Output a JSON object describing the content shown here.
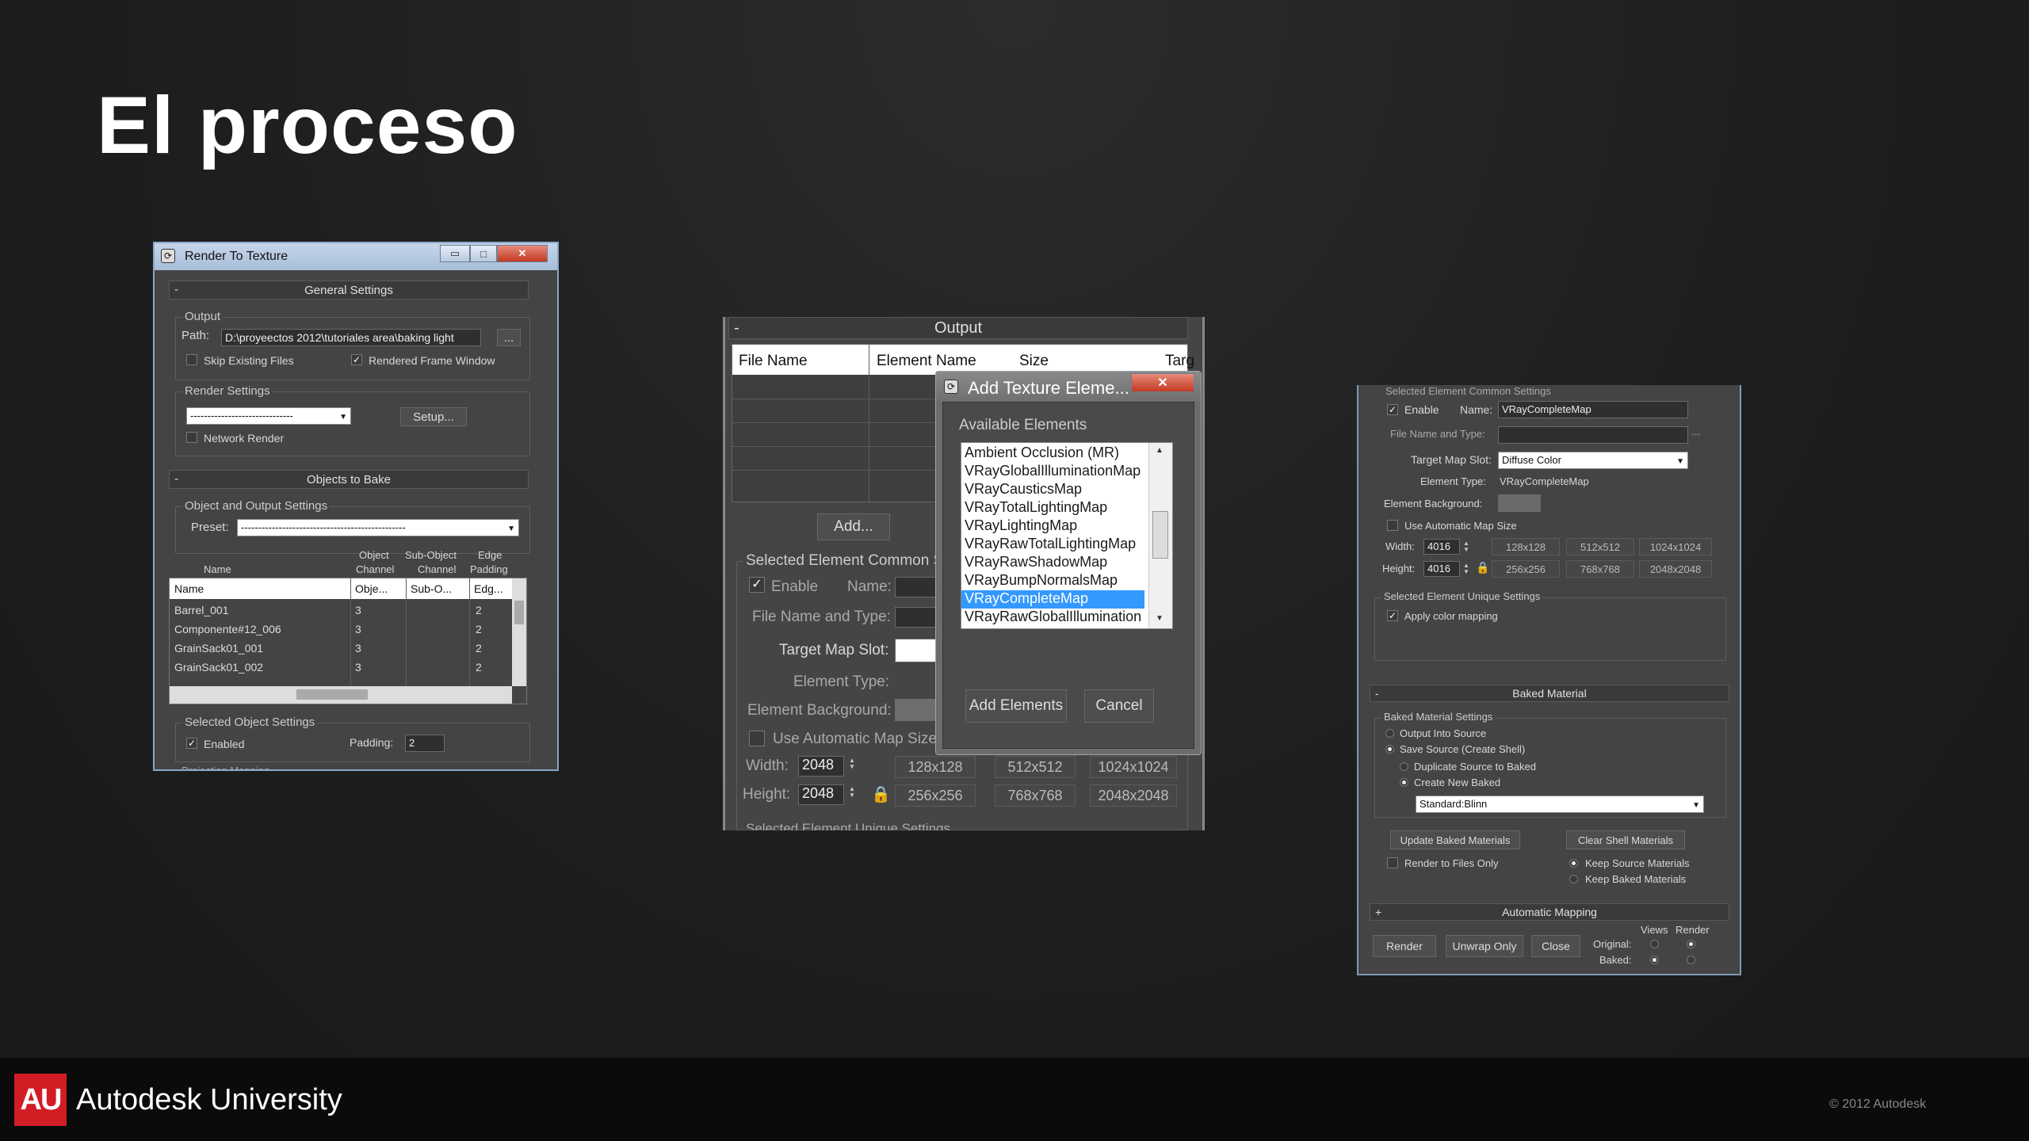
{
  "slide": {
    "title": "El proceso"
  },
  "footer": {
    "logo_text": "AU",
    "brand": "Autodesk University",
    "copyright": "© 2012 Autodesk",
    "logo_color": "#d31d25"
  },
  "win1": {
    "title": "Render To Texture",
    "min_btn": "▭",
    "max_btn": "□",
    "close_btn": "✕",
    "app_icon": "max-logo-icon",
    "general_settings": "General Settings",
    "output_label": "Output",
    "path_label": "Path:",
    "path_value": "D:\\proyeectos 2012\\tutoriales area\\baking light",
    "browse_btn": "...",
    "skip_existing": "Skip Existing Files",
    "rendered_frame_window": "Rendered Frame Window",
    "render_settings": "Render Settings",
    "render_preset_value": "------------------------------",
    "setup_btn": "Setup...",
    "network_render": "Network Render",
    "objects_to_bake": "Objects to Bake",
    "object_output_settings": "Object and Output Settings",
    "preset_label": "Preset:",
    "preset_value": "------------------------------------------------",
    "col_heads": {
      "name": "Name",
      "object_channel_1": "Object",
      "object_channel_2": "Channel",
      "subobject_channel_1": "Sub-Object",
      "subobject_channel_2": "Channel",
      "edge_padding_1": "Edge",
      "edge_padding_2": "Padding"
    },
    "table_header": [
      "Name",
      "Obje...",
      "Sub-O...",
      "Edg..."
    ],
    "rows": [
      [
        "Barrel_001",
        "3",
        "",
        "2"
      ],
      [
        "Componente#12_006",
        "3",
        "",
        "2"
      ],
      [
        "GrainSack01_001",
        "3",
        "",
        "2"
      ],
      [
        "GrainSack01_002",
        "3",
        "",
        "2"
      ]
    ],
    "selected_object_settings": "Selected Object Settings",
    "enabled": "Enabled",
    "padding_label": "Padding:",
    "padding_value": "2",
    "projection_mapping": "Projection Mapping"
  },
  "win2": {
    "output": "Output",
    "columns": [
      "File Name",
      "Element Name",
      "Size",
      "Targ"
    ],
    "add_btn": "Add...",
    "selected_element_common": "Selected Element Common S",
    "enable": "Enable",
    "name_label": "Name:",
    "file_name_type": "File Name and Type:",
    "target_map_slot": "Target Map Slot:",
    "element_type": "Element Type:",
    "element_background": "Element Background:",
    "use_auto_map_size": "Use Automatic Map Size",
    "width_label": "Width:",
    "width_value": "2048",
    "height_label": "Height:",
    "height_value": "2048",
    "sizes": [
      "128x128",
      "512x512",
      "1024x1024",
      "256x256",
      "768x768",
      "2048x2048"
    ],
    "selected_element_unique": "Selected Element Unique Settings"
  },
  "dialog": {
    "title": "Add Texture Eleme...",
    "close_btn": "✕",
    "available_elements": "Available Elements",
    "items": [
      "Ambient Occlusion (MR)",
      "VRayGlobalIlluminationMap",
      "VRayCausticsMap",
      "VRayTotalLightingMap",
      "VRayLightingMap",
      "VRayRawTotalLightingMap",
      "VRayRawShadowMap",
      "VRayBumpNormalsMap",
      "VRayCompleteMap",
      "VRayRawGlobalIllumination"
    ],
    "selected_item": "VRayCompleteMap",
    "add_elements_btn": "Add Elements",
    "cancel_btn": "Cancel"
  },
  "win3": {
    "selected_element_common": "Selected Element Common Settings",
    "enable": "Enable",
    "name_label": "Name:",
    "name_value": "VRayCompleteMap",
    "file_name_type": "File Name and Type:",
    "browse_btn": "...",
    "target_map_slot": "Target Map Slot:",
    "target_map_value": "Diffuse Color",
    "element_type_label": "Element Type:",
    "element_type_value": "VRayCompleteMap",
    "element_background": "Element Background:",
    "use_auto_map_size": "Use Automatic Map Size",
    "width_label": "Width:",
    "width_value": "4016",
    "height_label": "Height:",
    "height_value": "4016",
    "sizes": [
      "128x128",
      "512x512",
      "1024x1024",
      "256x256",
      "768x768",
      "2048x2048"
    ],
    "selected_element_unique": "Selected Element Unique Settings",
    "apply_color_mapping": "Apply color mapping",
    "baked_material": "Baked Material",
    "baked_material_settings": "Baked Material Settings",
    "output_into_source": "Output Into Source",
    "save_source": "Save Source (Create Shell)",
    "duplicate_source": "Duplicate Source to Baked",
    "create_new_baked": "Create New Baked",
    "material_value": "Standard:Blinn",
    "update_baked_btn": "Update Baked Materials",
    "clear_shell_btn": "Clear Shell Materials",
    "render_to_files_only": "Render to Files Only",
    "keep_source_materials": "Keep Source Materials",
    "keep_baked_materials": "Keep Baked Materials",
    "automatic_mapping": "Automatic Mapping",
    "render_btn": "Render",
    "unwrap_only_btn": "Unwrap Only",
    "close_btn": "Close",
    "views_label": "Views",
    "render_label": "Render",
    "original_label": "Original:",
    "baked_label": "Baked:"
  }
}
